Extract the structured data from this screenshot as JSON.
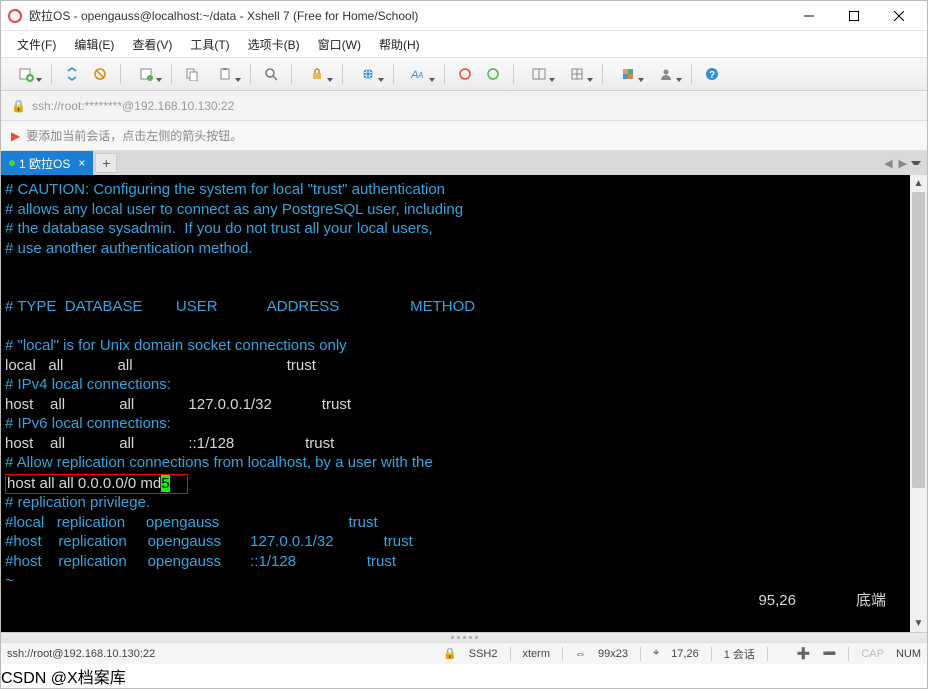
{
  "window": {
    "title": "欧拉OS - opengauss@localhost:~/data - Xshell 7 (Free for Home/School)"
  },
  "menu": {
    "file": "文件(F)",
    "edit": "编辑(E)",
    "view": "查看(V)",
    "tools": "工具(T)",
    "tabs": "选项卡(B)",
    "window": "窗口(W)",
    "help": "帮助(H)"
  },
  "address": {
    "url": "ssh://root:********@192.168.10.130:22"
  },
  "hint": {
    "text": "要添加当前会话，点击左侧的箭头按钮。"
  },
  "tab": {
    "label": "1 欧拉OS"
  },
  "terminal": {
    "l1": "# CAUTION: Configuring the system for local \"trust\" authentication",
    "l2": "# allows any local user to connect as any PostgreSQL user, including",
    "l3": "# the database sysadmin.  If you do not trust all your local users,",
    "l4": "# use another authentication method.",
    "l5": "",
    "l6": "",
    "l7": "# TYPE  DATABASE        USER            ADDRESS                 METHOD",
    "l8": "",
    "l9": "# \"local\" is for Unix domain socket connections only",
    "l10": "local   all             all                                     trust",
    "l11": "# IPv4 local connections:",
    "l12": "host    all             all             127.0.0.1/32            trust",
    "l13": "# IPv6 local connections:",
    "l14": "host    all             all             ::1/128                 trust",
    "l15": "# Allow replication connections from localhost, by a user with the",
    "l16a": "host all all 0.0.0.0/0 md",
    "l16b": "5",
    "l17": "# replication privilege.",
    "l18": "#local   replication     opengauss                               trust",
    "l19": "#host    replication     opengauss       127.0.0.1/32            trust",
    "l20": "#host    replication     opengauss       ::1/128                 trust",
    "l21": "~",
    "status_pos": "95,26",
    "status_mode": "底端"
  },
  "statusbar": {
    "conn": "ssh://root@192.168.10.130:22",
    "proto": "SSH2",
    "term": "xterm",
    "size": "99x23",
    "cursor": "17,26",
    "sessions": "1 会话",
    "cap": "CAP",
    "num": "NUM"
  },
  "watermark": "CSDN @X档案库"
}
